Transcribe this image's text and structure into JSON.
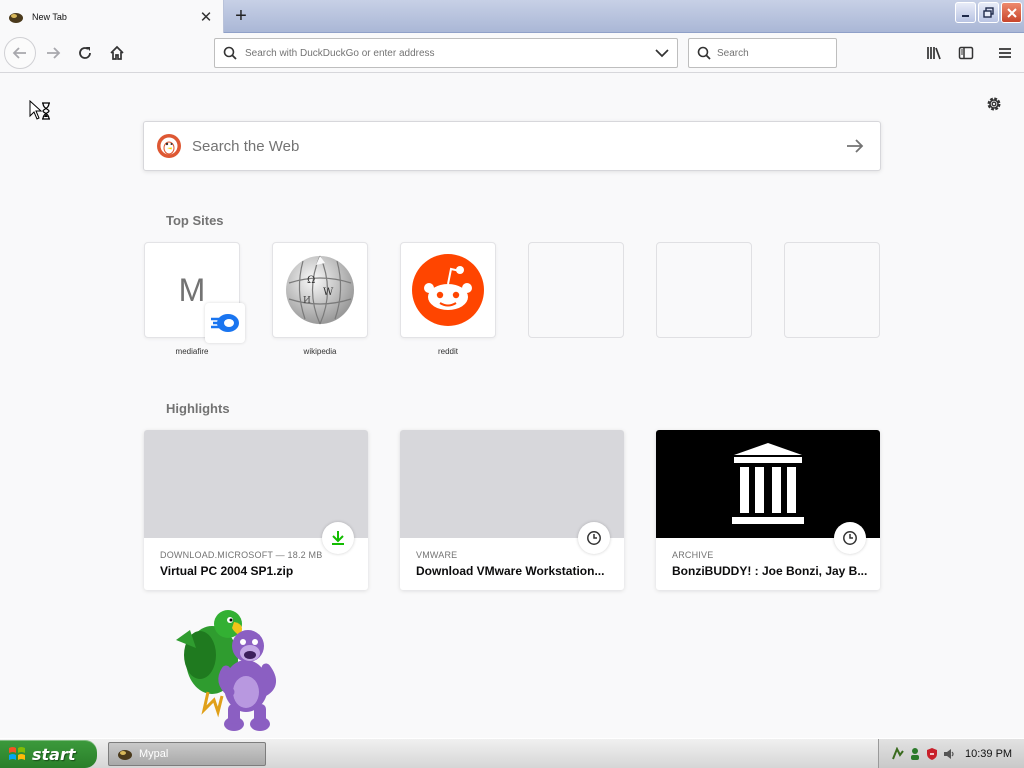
{
  "browser": {
    "tab": {
      "title": "New Tab"
    },
    "urlbar": {
      "placeholder": "Search with DuckDuckGo or enter address"
    },
    "searchbar": {
      "placeholder": "Search"
    }
  },
  "newtab": {
    "search_placeholder": "Search the Web",
    "top_sites_heading": "Top Sites",
    "top_sites": [
      {
        "label": "mediafire",
        "letter": "M"
      },
      {
        "label": "wikipedia"
      },
      {
        "label": "reddit"
      }
    ],
    "highlights_heading": "Highlights",
    "highlights": [
      {
        "source": "DOWNLOAD.MICROSOFT — 18.2 MB",
        "title": "Virtual PC 2004 SP1.zip",
        "icon": "download-icon"
      },
      {
        "source": "VMWARE",
        "title": "Download VMware Workstation...",
        "icon": "clock-icon"
      },
      {
        "source": "ARCHIVE",
        "title": "BonziBUDDY! : Joe Bonzi, Jay B...",
        "icon": "clock-icon"
      }
    ]
  },
  "taskbar": {
    "start_label": "start",
    "task_label": "Mypal",
    "clock": "10:39 PM"
  },
  "colors": {
    "reddit": "#ff4500",
    "ddg": "#de5833",
    "mediafire": "#1a75f0",
    "download": "#12bc00"
  }
}
